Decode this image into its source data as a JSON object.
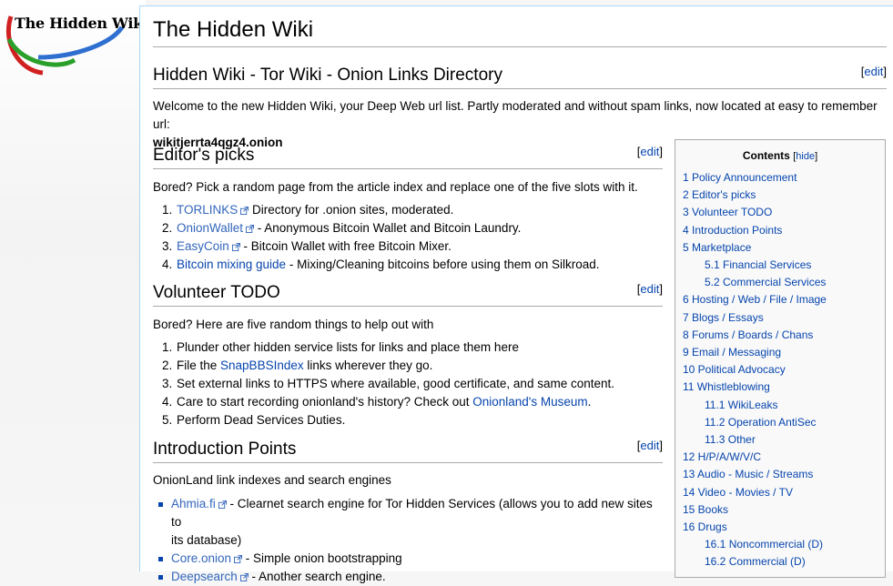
{
  "logo": {
    "text": "The Hidden Wiki"
  },
  "page_title": "The Hidden Wiki",
  "edit_label": "edit",
  "sections": {
    "intro": {
      "heading": "Hidden Wiki - Tor Wiki - Onion Links Directory",
      "welcome": "Welcome to the new Hidden Wiki, your Deep Web url list. Partly moderated and without spam links, now located at easy to remember url:",
      "url": "wikitjerrta4qgz4.onion"
    },
    "editors_picks": {
      "heading": "Editor's picks",
      "lead": "Bored? Pick a random page from the article index and replace one of the five slots with it.",
      "items": [
        {
          "num": "1.",
          "link": "TORLINKS",
          "text": " Directory for .onion sites, moderated."
        },
        {
          "num": "2.",
          "link": "OnionWallet",
          "text": " - Anonymous Bitcoin Wallet and Bitcoin Laundry."
        },
        {
          "num": "3.",
          "link": "EasyCoin",
          "text": " - Bitcoin Wallet with free Bitcoin Mixer."
        },
        {
          "num": "4.",
          "link": "Bitcoin mixing guide",
          "text": " - Mixing/Cleaning bitcoins before using them on Silkroad."
        }
      ]
    },
    "volunteer": {
      "heading": "Volunteer TODO",
      "lead": "Bored? Here are five random things to help out with",
      "items": [
        {
          "num": "1.",
          "pre": "Plunder other hidden service lists for links and place them here",
          "link": "",
          "post": ""
        },
        {
          "num": "2.",
          "pre": "File the ",
          "link": "SnapBBSIndex",
          "post": " links wherever they go."
        },
        {
          "num": "3.",
          "pre": "Set external links to HTTPS where available, good certificate, and same content.",
          "link": "",
          "post": ""
        },
        {
          "num": "4.",
          "pre": "Care to start recording onionland's history? Check out ",
          "link": "Onionland's Museum",
          "post": "."
        },
        {
          "num": "5.",
          "pre": "Perform Dead Services Duties.",
          "link": "",
          "post": ""
        }
      ]
    },
    "introduction_points": {
      "heading": "Introduction Points",
      "lead": "OnionLand link indexes and search engines",
      "items": [
        {
          "link": "Ahmia.fi",
          "text": " - Clearnet search engine for Tor Hidden Services (allows you to add new sites to",
          "text2": "its database)"
        },
        {
          "link": "Core.onion",
          "text": " - Simple onion bootstrapping",
          "text2": ""
        },
        {
          "link": "Deepsearch",
          "text": " - Another search engine.",
          "text2": ""
        }
      ]
    }
  },
  "toc": {
    "title": "Contents",
    "hide": "hide",
    "items": [
      {
        "label": "1 Policy Announcement",
        "sub": false
      },
      {
        "label": "2 Editor's picks",
        "sub": false
      },
      {
        "label": "3 Volunteer TODO",
        "sub": false
      },
      {
        "label": "4 Introduction Points",
        "sub": false
      },
      {
        "label": "5 Marketplace",
        "sub": false
      },
      {
        "label": "5.1 Financial Services",
        "sub": true
      },
      {
        "label": "5.2 Commercial Services",
        "sub": true
      },
      {
        "label": "6 Hosting / Web / File / Image",
        "sub": false
      },
      {
        "label": "7 Blogs / Essays",
        "sub": false
      },
      {
        "label": "8 Forums / Boards / Chans",
        "sub": false
      },
      {
        "label": "9 Email / Messaging",
        "sub": false
      },
      {
        "label": "10 Political Advocacy",
        "sub": false
      },
      {
        "label": "11 Whistleblowing",
        "sub": false
      },
      {
        "label": "11.1 WikiLeaks",
        "sub": true
      },
      {
        "label": "11.2 Operation AntiSec",
        "sub": true
      },
      {
        "label": "11.3 Other",
        "sub": true
      },
      {
        "label": "12 H/P/A/W/V/C",
        "sub": false
      },
      {
        "label": "13 Audio - Music / Streams",
        "sub": false
      },
      {
        "label": "14 Video - Movies / TV",
        "sub": false
      },
      {
        "label": "15 Books",
        "sub": false
      },
      {
        "label": "16 Drugs",
        "sub": false
      },
      {
        "label": "16.1 Noncommercial (D)",
        "sub": true
      },
      {
        "label": "16.2 Commercial (D)",
        "sub": true
      }
    ]
  },
  "colors": {
    "link": "#0645ad",
    "content_border": "#a7d7f9",
    "toc_bg": "#f9f9f9"
  }
}
